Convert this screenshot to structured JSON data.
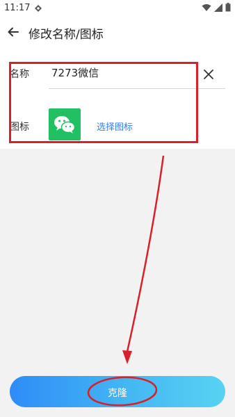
{
  "status_bar": {
    "time": "11:17"
  },
  "app_bar": {
    "title": "修改名称/图标"
  },
  "form": {
    "name_label": "名称",
    "name_value": "7273微信",
    "icon_label": "图标",
    "choose_icon": "选择图标"
  },
  "footer": {
    "clone_label": "克隆"
  },
  "colors": {
    "highlight": "#d8202a",
    "accent": "#2f7ff0",
    "wechat_green": "#21c063"
  },
  "icons": [
    "back-arrow-icon",
    "clear-icon",
    "wechat-icon",
    "wifi-icon",
    "signal-icon",
    "battery-icon"
  ]
}
